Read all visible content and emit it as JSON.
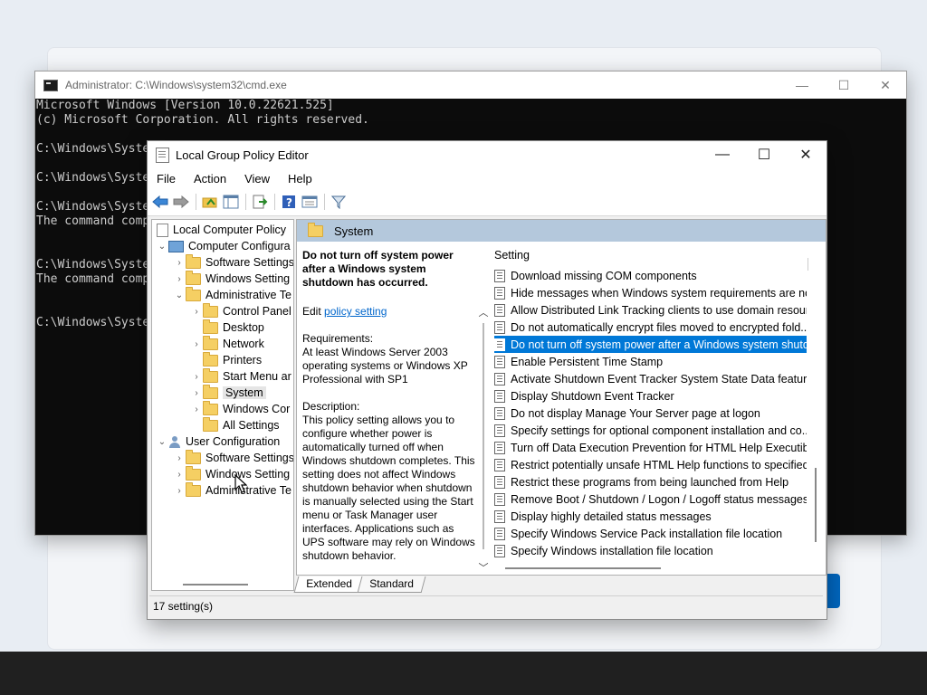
{
  "cmd": {
    "title": "Administrator: C:\\Windows\\system32\\cmd.exe",
    "lines": [
      "Microsoft Windows [Version 10.0.22621.525]",
      "(c) Microsoft Corporation. All rights reserved.",
      "",
      "C:\\Windows\\Syste",
      "",
      "C:\\Windows\\Syste",
      "",
      "C:\\Windows\\Syste",
      "The command comp",
      "",
      "",
      "C:\\Windows\\Syste",
      "The command comp",
      "",
      "",
      "C:\\Windows\\Syste"
    ],
    "controls": {
      "minimize": "—",
      "maximize": "☐",
      "close": "✕"
    }
  },
  "gpe": {
    "title": "Local Group Policy Editor",
    "controls": {
      "minimize": "—",
      "maximize": "☐",
      "close": "✕"
    },
    "menu": [
      "File",
      "Action",
      "View",
      "Help"
    ],
    "tree": {
      "root": "Local Computer Policy",
      "computer_config": "Computer Configura",
      "software_settings": "Software Settings",
      "windows_settings": "Windows Setting",
      "admin_templates": "Administrative Te",
      "control_panel": "Control Panel",
      "desktop": "Desktop",
      "network": "Network",
      "printers": "Printers",
      "start_menu": "Start Menu ar",
      "system": "System",
      "windows_components": "Windows Cor",
      "all_settings": "All Settings",
      "user_config": "User Configuration",
      "user_software_settings": "Software Settings",
      "user_windows_settings": "Windows Setting",
      "user_admin_templates": "Administrative Te"
    },
    "header": "System",
    "description": {
      "title": "Do not turn off system power after a Windows system shutdown has occurred.",
      "edit_prefix": "Edit",
      "edit_link": "policy setting",
      "requirements_label": "Requirements:",
      "requirements_text": "At least Windows Server 2003 operating systems or Windows XP Professional with SP1",
      "description_label": "Description:",
      "description_text": "This policy setting allows you to configure whether power is automatically turned off when Windows shutdown completes. This setting does not affect Windows shutdown behavior when shutdown is manually selected using the Start menu or Task Manager user interfaces. Applications such as UPS software may rely on Windows shutdown behavior."
    },
    "list": {
      "column": "Setting",
      "selected_index": 4,
      "items": [
        "Download missing COM components",
        "Hide messages when Windows system requirements are not...",
        "Allow Distributed Link Tracking clients to use domain resour...",
        "Do not automatically encrypt files moved to encrypted fold...",
        "Do not turn off system power after a Windows system shutd...",
        "Enable Persistent Time Stamp",
        "Activate Shutdown Event Tracker System State Data feature",
        "Display Shutdown Event Tracker",
        "Do not display Manage Your Server page at logon",
        "Specify settings for optional component installation and co...",
        "Turn off Data Execution Prevention for HTML Help Executible",
        "Restrict potentially unsafe HTML Help functions to specified...",
        "Restrict these programs from being launched from Help",
        "Remove Boot / Shutdown / Logon / Logoff status messages",
        "Display highly detailed status messages",
        "Specify Windows Service Pack installation file location",
        "Specify Windows installation file location"
      ]
    },
    "tabs": [
      "Extended",
      "Standard"
    ],
    "status": "17 setting(s)"
  }
}
